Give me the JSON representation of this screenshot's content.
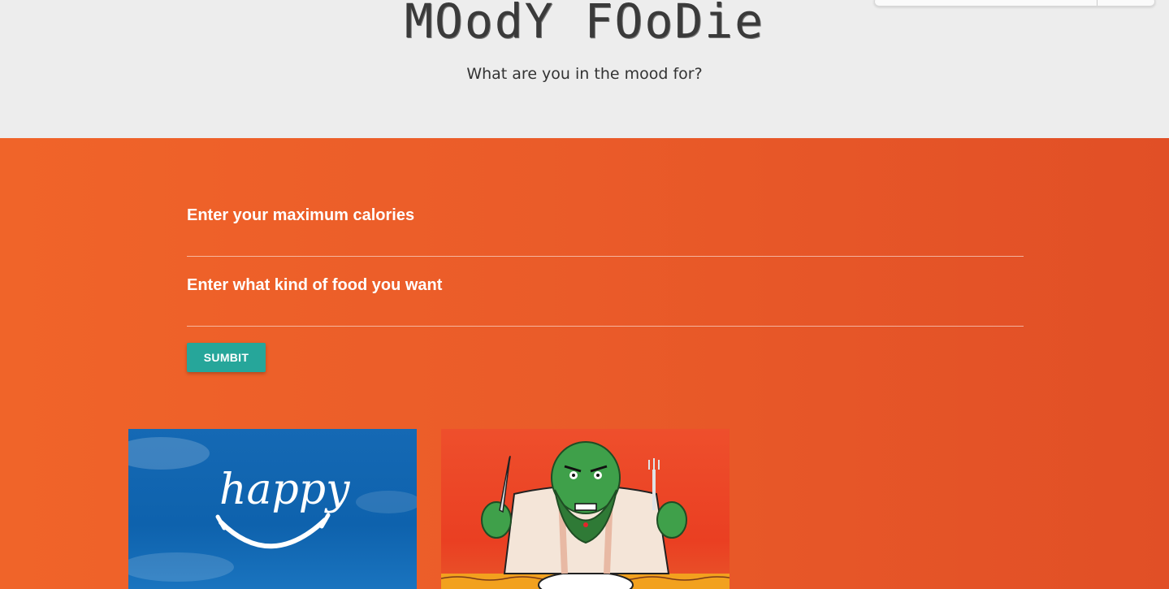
{
  "header": {
    "title": "MOodY FOoDie",
    "tagline": "What are you in the mood for?"
  },
  "form": {
    "calories_label": "Enter your maximum calories",
    "calories_value": "",
    "food_label": "Enter what kind of food you want",
    "food_value": "",
    "submit_label": "SUMBIT"
  },
  "cards": [
    {
      "name": "happy",
      "caption": "happy"
    },
    {
      "name": "angry"
    }
  ],
  "colors": {
    "accent": "#26a69a",
    "background_start": "#f06429",
    "background_end": "#e14f26",
    "header_bg": "#ededed"
  }
}
